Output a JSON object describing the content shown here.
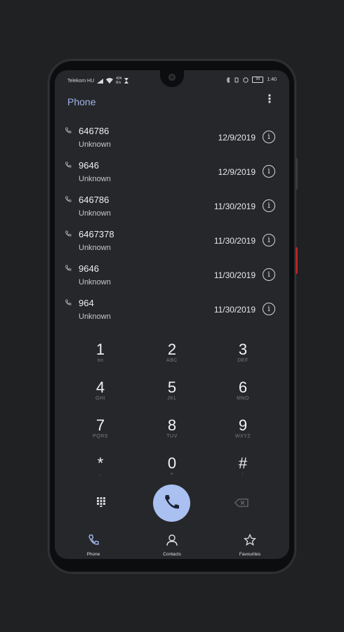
{
  "status": {
    "carrier": "Telekom HU",
    "speed_top": "404",
    "speed_unit": "B/s",
    "battery": "99",
    "time": "1:40"
  },
  "app": {
    "title": "Phone",
    "more_icon": "more-vert-icon"
  },
  "calls": [
    {
      "number": "646786",
      "label": "Unknown",
      "date": "12/9/2019"
    },
    {
      "number": "9646",
      "label": "Unknown",
      "date": "12/9/2019"
    },
    {
      "number": "646786",
      "label": "Unknown",
      "date": "11/30/2019"
    },
    {
      "number": "6467378",
      "label": "Unknown",
      "date": "11/30/2019"
    },
    {
      "number": "9646",
      "label": "Unknown",
      "date": "11/30/2019"
    },
    {
      "number": "964",
      "label": "Unknown",
      "date": "11/30/2019"
    }
  ],
  "keys": [
    {
      "digit": "1",
      "letters": "oo"
    },
    {
      "digit": "2",
      "letters": "ABC"
    },
    {
      "digit": "3",
      "letters": "DEF"
    },
    {
      "digit": "4",
      "letters": "GHI"
    },
    {
      "digit": "5",
      "letters": "JKL"
    },
    {
      "digit": "6",
      "letters": "MNO"
    },
    {
      "digit": "7",
      "letters": "PQRS"
    },
    {
      "digit": "8",
      "letters": "TUV"
    },
    {
      "digit": "9",
      "letters": "WXYZ"
    },
    {
      "digit": "*",
      "letters": ","
    },
    {
      "digit": "0",
      "letters": "+"
    },
    {
      "digit": "#",
      "letters": ";"
    }
  ],
  "nav": {
    "phone": "Phone",
    "contacts": "Contacts",
    "favourites": "Favourites"
  },
  "colors": {
    "accent": "#9fb3e8",
    "call_button": "#a9c0f1",
    "background": "#26272a"
  }
}
